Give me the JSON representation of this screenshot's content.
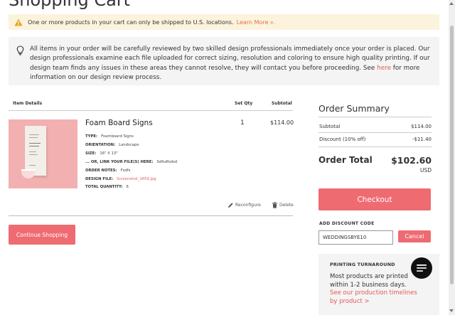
{
  "page": {
    "title": "Shopping Cart"
  },
  "warning": {
    "text": "One or more products in your cart can only be shipped to U.S. locations.",
    "link": "Learn More »."
  },
  "info": {
    "text_before": "All items in your order will be carefully reviewed by two skilled design professionals immediately once your order is placed. Our design professionals examine each file uploaded for correct sizing, resolution and coloring to ensure high quality printing. If our design team finds any issues in these areas they cannot resolve, they will contact you before proceeding. See",
    "link": "here",
    "text_after": "for more information on our design review process."
  },
  "table": {
    "headers": {
      "item": "Item Details",
      "qty": "Set Qty",
      "subtotal": "Subtotal"
    }
  },
  "item": {
    "name": "Foam Board Signs",
    "qty": "1",
    "subtotal": "$114.00",
    "specs": [
      {
        "label": "TYPE:",
        "value": "Foamboard Signs"
      },
      {
        "label": "ORIENTATION:",
        "value": "Landscape"
      },
      {
        "label": "SIZE:",
        "value": "16\" X 13\""
      },
      {
        "label": "... OR, LINK YOUR FILE(S) HERE:",
        "value": "Sdfsdfsdsd"
      },
      {
        "label": "ORDER NOTES:",
        "value": "Fsdfs"
      },
      {
        "label": "DESIGN FILE:",
        "value": "Screenshot_1659.jpg"
      },
      {
        "label": "TOTAL QUANTITY:",
        "value": "6"
      }
    ],
    "reconfigure": "Reconfigure",
    "delete": "Delete"
  },
  "continue_button": "Continue Shopping",
  "summary": {
    "title": "Order Summary",
    "subtotal_label": "Subtotal",
    "subtotal_value": "$114.00",
    "discount_label": "Discount (10% off)",
    "discount_value": "-$11.40",
    "total_label": "Order Total",
    "total_value": "$102.60",
    "currency": "USD",
    "checkout": "Checkout"
  },
  "discount_code": {
    "label": "ADD DISCOUNT CODE",
    "value": "WEDDINGSBYE10",
    "cancel": "Cancel"
  },
  "turnaround": {
    "title": "PRINTING TURNAROUND",
    "text": "Most products are printed within 1-2 business days.",
    "link": "See our production timelines by product >"
  },
  "icons": {
    "warning": "warning-triangle-icon",
    "info": "lightbulb-icon",
    "reconfigure": "pencil-icon",
    "delete": "trash-icon",
    "chat": "chat-icon"
  },
  "colors": {
    "accent": "#ef6b72",
    "link": "#e05a5a",
    "warning_bg": "#fcf3dd",
    "panel_bg": "#f4f4f4"
  }
}
